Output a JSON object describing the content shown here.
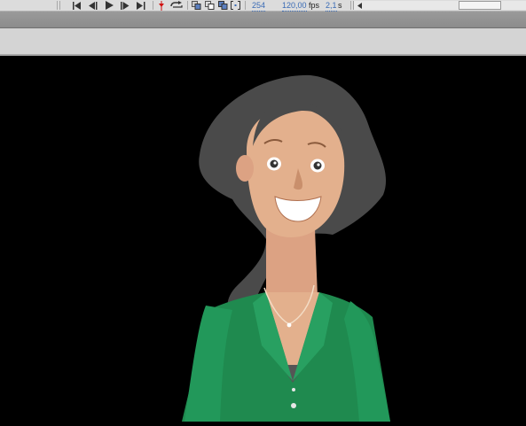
{
  "timeline": {
    "frame_label": "254",
    "fps_value": "120,00",
    "fps_unit": "fps",
    "time_value": "2,1",
    "time_unit": "s"
  },
  "icons": {
    "first": "go-to-first-frame-icon",
    "prev": "step-back-icon",
    "play": "play-icon",
    "next": "step-forward-icon",
    "last": "go-to-last-frame-icon",
    "loop": "loop-icon",
    "onion": "onion-skin-icon",
    "edit_multiple": "edit-multiple-frames-icon"
  },
  "colors": {
    "stage_background": "#000000",
    "hair": "#4a4a4a",
    "skin": "#e3b08d",
    "shirt": "#1f8a4f",
    "accent_blue": "#3a6bb5"
  }
}
